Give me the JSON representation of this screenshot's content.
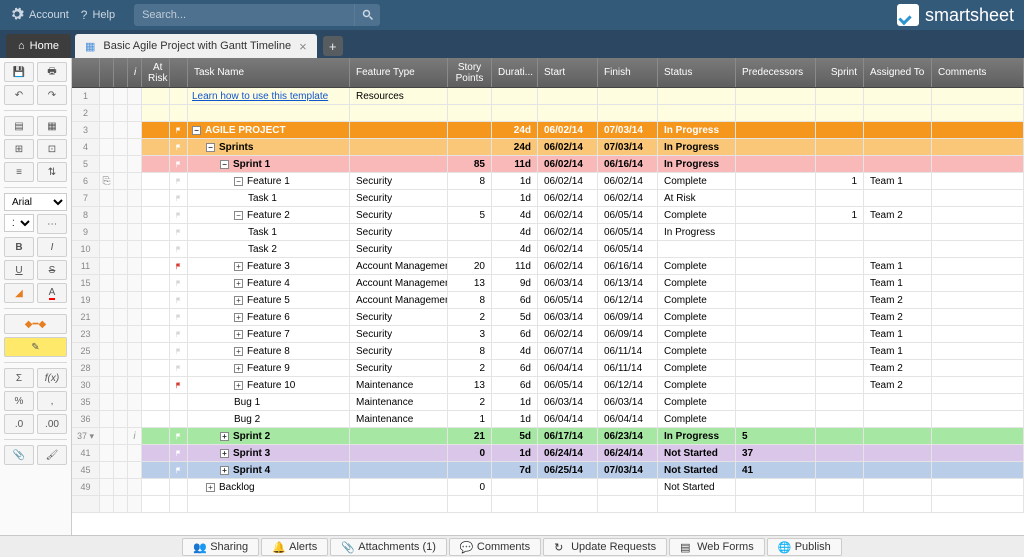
{
  "topbar": {
    "account": "Account",
    "help": "Help",
    "search_placeholder": "Search...",
    "brand": "smartsheet"
  },
  "tabs": {
    "home": "Home",
    "sheet": "Basic Agile Project with Gantt Timeline"
  },
  "toolbar": {
    "font": "Arial",
    "size": "10"
  },
  "columns": {
    "atrisk": "At Risk",
    "task": "Task Name",
    "feature": "Feature Type",
    "story": "Story Points",
    "duration": "Durati...",
    "start": "Start",
    "finish": "Finish",
    "status": "Status",
    "pred": "Predecessors",
    "sprint": "Sprint",
    "assigned": "Assigned To",
    "comments": "Comments"
  },
  "rows": [
    {
      "n": 1,
      "bg": "yellow",
      "task": "Learn how to use this template",
      "link": true,
      "feat": "Resources"
    },
    {
      "n": 2,
      "bg": "yellow"
    },
    {
      "n": 3,
      "bg": "orange",
      "exp": "-",
      "indent": 0,
      "task": "AGILE PROJECT",
      "dur": "24d",
      "start": "06/02/14",
      "fin": "07/03/14",
      "stat": "In Progress",
      "flag": "white"
    },
    {
      "n": 4,
      "bg": "lorange",
      "exp": "-",
      "indent": 1,
      "task": "Sprints",
      "dur": "24d",
      "start": "06/02/14",
      "fin": "07/03/14",
      "stat": "In Progress",
      "flag": "white"
    },
    {
      "n": 5,
      "bg": "pink",
      "exp": "-",
      "indent": 2,
      "task": "Sprint 1",
      "story": "85",
      "dur": "11d",
      "start": "06/02/14",
      "fin": "06/16/14",
      "stat": "In Progress",
      "flag": "white"
    },
    {
      "n": 6,
      "exp": "-",
      "indent": 3,
      "task": "Feature 1",
      "feat": "Security",
      "story": "8",
      "dur": "1d",
      "start": "06/02/14",
      "fin": "06/02/14",
      "stat": "Complete",
      "sprint": "1",
      "assign": "Team 1",
      "flag": "gray",
      "clip": true
    },
    {
      "n": 7,
      "indent": 4,
      "task": "Task 1",
      "feat": "Security",
      "dur": "1d",
      "start": "06/02/14",
      "fin": "06/02/14",
      "stat": "At Risk",
      "flag": "gray"
    },
    {
      "n": 8,
      "exp": "-",
      "indent": 3,
      "task": "Feature 2",
      "feat": "Security",
      "story": "5",
      "dur": "4d",
      "start": "06/02/14",
      "fin": "06/05/14",
      "stat": "Complete",
      "sprint": "1",
      "assign": "Team 2",
      "flag": "gray"
    },
    {
      "n": 9,
      "indent": 4,
      "task": "Task 1",
      "feat": "Security",
      "dur": "4d",
      "start": "06/02/14",
      "fin": "06/05/14",
      "stat": "In Progress",
      "flag": "gray"
    },
    {
      "n": 10,
      "indent": 4,
      "task": "Task 2",
      "feat": "Security",
      "dur": "4d",
      "start": "06/02/14",
      "fin": "06/05/14",
      "flag": "gray"
    },
    {
      "n": 11,
      "exp": "+",
      "indent": 3,
      "task": "Feature 3",
      "feat": "Account Managemen",
      "story": "20",
      "dur": "11d",
      "start": "06/02/14",
      "fin": "06/16/14",
      "stat": "Complete",
      "assign": "Team 1",
      "flag": "red"
    },
    {
      "n": 15,
      "exp": "+",
      "indent": 3,
      "task": "Feature 4",
      "feat": "Account Managemen",
      "story": "13",
      "dur": "9d",
      "start": "06/03/14",
      "fin": "06/13/14",
      "stat": "Complete",
      "assign": "Team 1",
      "flag": "gray"
    },
    {
      "n": 19,
      "exp": "+",
      "indent": 3,
      "task": "Feature 5",
      "feat": "Account Managemen",
      "story": "8",
      "dur": "6d",
      "start": "06/05/14",
      "fin": "06/12/14",
      "stat": "Complete",
      "assign": "Team 2",
      "flag": "gray"
    },
    {
      "n": 21,
      "exp": "+",
      "indent": 3,
      "task": "Feature 6",
      "feat": "Security",
      "story": "2",
      "dur": "5d",
      "start": "06/03/14",
      "fin": "06/09/14",
      "stat": "Complete",
      "assign": "Team 2",
      "flag": "gray"
    },
    {
      "n": 23,
      "exp": "+",
      "indent": 3,
      "task": "Feature 7",
      "feat": "Security",
      "story": "3",
      "dur": "6d",
      "start": "06/02/14",
      "fin": "06/09/14",
      "stat": "Complete",
      "assign": "Team 1",
      "flag": "gray"
    },
    {
      "n": 25,
      "exp": "+",
      "indent": 3,
      "task": "Feature 8",
      "feat": "Security",
      "story": "8",
      "dur": "4d",
      "start": "06/07/14",
      "fin": "06/11/14",
      "stat": "Complete",
      "assign": "Team 1",
      "flag": "gray"
    },
    {
      "n": 28,
      "exp": "+",
      "indent": 3,
      "task": "Feature 9",
      "feat": "Security",
      "story": "2",
      "dur": "6d",
      "start": "06/04/14",
      "fin": "06/11/14",
      "stat": "Complete",
      "assign": "Team 2",
      "flag": "gray"
    },
    {
      "n": 30,
      "exp": "+",
      "indent": 3,
      "task": "Feature 10",
      "feat": "Maintenance",
      "story": "13",
      "dur": "6d",
      "start": "06/05/14",
      "fin": "06/12/14",
      "stat": "Complete",
      "assign": "Team 2",
      "flag": "red"
    },
    {
      "n": 35,
      "indent": 3,
      "task": "Bug 1",
      "feat": "Maintenance",
      "story": "2",
      "dur": "1d",
      "start": "06/03/14",
      "fin": "06/03/14",
      "stat": "Complete"
    },
    {
      "n": 36,
      "indent": 3,
      "task": "Bug 2",
      "feat": "Maintenance",
      "story": "1",
      "dur": "1d",
      "start": "06/04/14",
      "fin": "06/04/14",
      "stat": "Complete"
    },
    {
      "n": 37,
      "bg": "green",
      "exp": "+",
      "indent": 2,
      "task": "Sprint 2",
      "story": "21",
      "dur": "5d",
      "start": "06/17/14",
      "fin": "06/23/14",
      "stat": "In Progress",
      "pred": "5",
      "flag": "white",
      "sel": true
    },
    {
      "n": 41,
      "bg": "purple",
      "exp": "+",
      "indent": 2,
      "task": "Sprint 3",
      "story": "0",
      "dur": "1d",
      "start": "06/24/14",
      "fin": "06/24/14",
      "stat": "Not Started",
      "pred": "37",
      "flag": "white"
    },
    {
      "n": 45,
      "bg": "blue",
      "exp": "+",
      "indent": 2,
      "task": "Sprint 4",
      "dur": "7d",
      "start": "06/25/14",
      "fin": "07/03/14",
      "stat": "Not Started",
      "pred": "41",
      "flag": "white"
    },
    {
      "n": 49,
      "exp": "+",
      "indent": 1,
      "task": "Backlog",
      "story": "0",
      "stat": "Not Started"
    },
    {
      "n": ""
    }
  ],
  "footer": {
    "sharing": "Sharing",
    "alerts": "Alerts",
    "attachments": "Attachments (1)",
    "comments": "Comments",
    "update": "Update Requests",
    "webforms": "Web Forms",
    "publish": "Publish"
  }
}
